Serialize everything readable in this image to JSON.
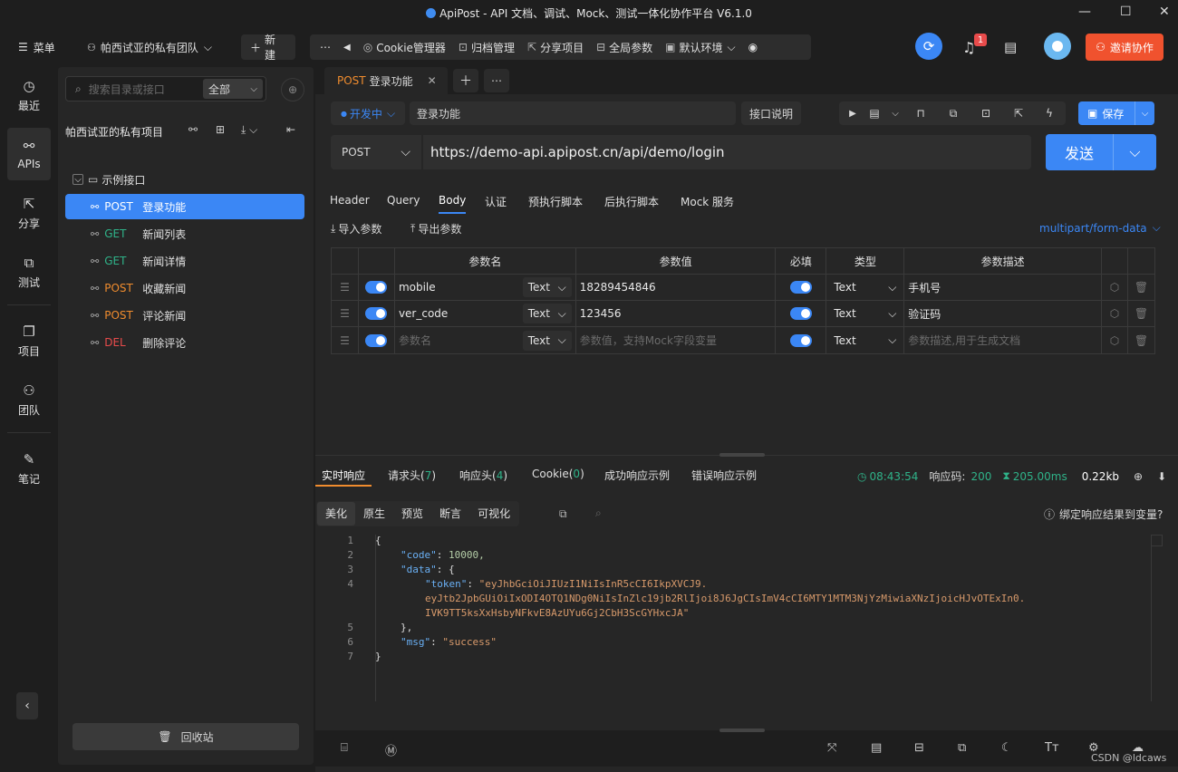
{
  "window": {
    "title": "ApiPost - API 文档、调试、Mock、测试一体化协作平台 V6.1.0"
  },
  "toolbar": {
    "menu_label": "菜单",
    "team_label": "帕西试亚的私有团队",
    "new_label": "新建",
    "shortcuts": [
      "Cookie管理器",
      "归档管理",
      "分享项目",
      "全局参数",
      "默认环境"
    ],
    "notification_count": "1",
    "invite_label": "邀请协作"
  },
  "leftnav": {
    "items": [
      {
        "label": "最近",
        "icon": "clock-icon"
      },
      {
        "label": "APIs",
        "icon": "link-icon"
      },
      {
        "label": "分享",
        "icon": "share-icon"
      },
      {
        "label": "测试",
        "icon": "test-icon"
      },
      {
        "label": "项目",
        "icon": "project-icon"
      },
      {
        "label": "团队",
        "icon": "team-icon"
      },
      {
        "label": "笔记",
        "icon": "note-icon"
      }
    ]
  },
  "sidebar": {
    "search_placeholder": "搜索目录或接口",
    "filter_value": "全部",
    "project_title": "帕西试亚的私有项目",
    "folder": "示例接口",
    "items": [
      {
        "method": "POST",
        "name": "登录功能"
      },
      {
        "method": "GET",
        "name": "新闻列表"
      },
      {
        "method": "GET",
        "name": "新闻详情"
      },
      {
        "method": "POST",
        "name": "收藏新闻"
      },
      {
        "method": "POST",
        "name": "评论新闻"
      },
      {
        "method": "DEL",
        "name": "删除评论"
      }
    ],
    "recycle_label": "回收站"
  },
  "tab": {
    "method": "POST",
    "name": "登录功能"
  },
  "request": {
    "status": "开发中",
    "name": "登录功能",
    "doc_label": "接口说明",
    "save_label": "保存",
    "method": "POST",
    "url": "https://demo-api.apipost.cn/api/demo/login",
    "send_label": "发送"
  },
  "param_tabs": [
    "Header",
    "Query",
    "Body",
    "认证",
    "预执行脚本",
    "后执行脚本",
    "Mock 服务"
  ],
  "body": {
    "import_label": "导入参数",
    "export_label": "导出参数",
    "content_type": "multipart/form-data",
    "headers": [
      "参数名",
      "参数值",
      "必填",
      "类型",
      "参数描述"
    ],
    "rows": [
      {
        "name": "mobile",
        "ftype": "Text",
        "value": "18289454846",
        "type": "Text",
        "desc": "手机号"
      },
      {
        "name": "ver_code",
        "ftype": "Text",
        "value": "123456",
        "type": "Text",
        "desc": "验证码"
      }
    ],
    "empty_row": {
      "name_ph": "参数名",
      "ftype": "Text",
      "value_ph": "参数值，支持Mock字段变量",
      "type": "Text",
      "desc_ph": "参数描述,用于生成文档"
    }
  },
  "response": {
    "tabs": [
      {
        "label": "实时响应",
        "count": ""
      },
      {
        "label": "请求头",
        "count": "7"
      },
      {
        "label": "响应头",
        "count": "4"
      },
      {
        "label": "Cookie",
        "count": "0"
      },
      {
        "label": "成功响应示例",
        "count": ""
      },
      {
        "label": "错误响应示例",
        "count": ""
      }
    ],
    "time": "08:43:54",
    "code_label": "响应码:",
    "code": "200",
    "duration": "205.00ms",
    "size": "0.22kb",
    "view_tabs": [
      "美化",
      "原生",
      "预览",
      "断言",
      "可视化"
    ],
    "bind_label": "绑定响应结果到变量?",
    "json_lines": [
      {
        "n": "1",
        "t": "{"
      },
      {
        "n": "2",
        "key": "\"code\"",
        "val": "10000,",
        "kind": "num",
        "indent": 1
      },
      {
        "n": "3",
        "key": "\"data\"",
        "val": "{",
        "kind": "plain",
        "indent": 1
      },
      {
        "n": "4",
        "key": "\"token\"",
        "val": "\"eyJhbGciOiJIUzI1NiIsInR5cCI6IkpXVCJ9.",
        "kind": "str",
        "indent": 2
      },
      {
        "n": "",
        "cont": "eyJtb2JpbGUiOiIxODI4OTQ1NDg0NiIsInZlc19jb2RlIjoi8J6JgCIsImV4cCI6MTY1MTM3NjYzMiwiaXNzIjoicHJvOTExIn0."
      },
      {
        "n": "",
        "cont": "IVK9TT5ksXxHsbyNFkvE8AzUYu6Gj2CbH3ScGYHxcJA\""
      },
      {
        "n": "5",
        "t": "},",
        "indent": 1
      },
      {
        "n": "6",
        "key": "\"msg\"",
        "val": "\"success\"",
        "kind": "str",
        "indent": 1
      },
      {
        "n": "7",
        "t": "}"
      }
    ]
  },
  "watermark": "CSDN @ldcaws"
}
